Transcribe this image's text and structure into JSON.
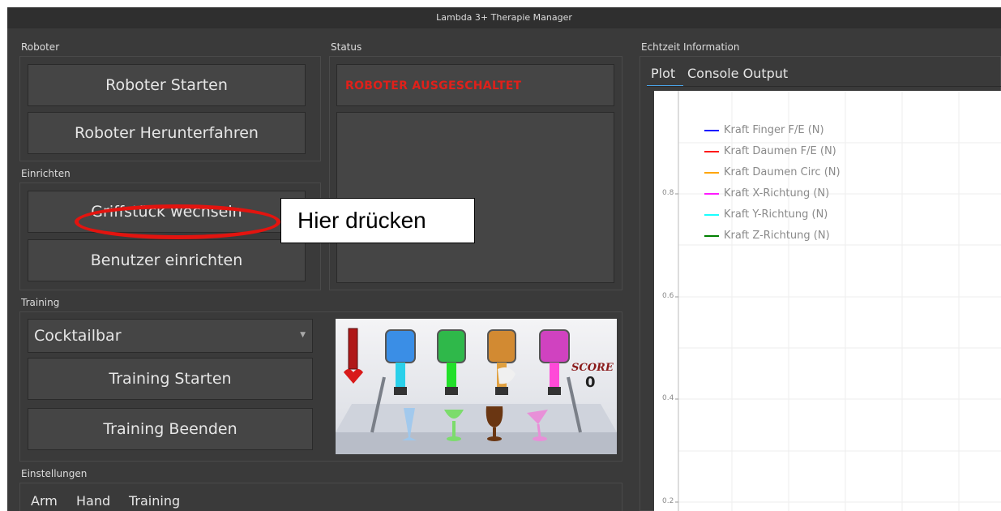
{
  "window": {
    "title": "Lambda 3+ Therapie Manager"
  },
  "roboter": {
    "label": "Roboter",
    "start_label": "Roboter Starten",
    "shutdown_label": "Roboter Herunterfahren"
  },
  "status": {
    "label": "Status",
    "text": "ROBOTER AUSGESCHALTET",
    "color": "#e0201a"
  },
  "einrichten": {
    "label": "Einrichten",
    "griff_label": "Griffstück wechseln",
    "benutzer_label": "Benutzer einrichten"
  },
  "training": {
    "label": "Training",
    "game_selected": "Cocktailbar",
    "start_label": "Training Starten",
    "stop_label": "Training Beenden",
    "preview": {
      "score_label": "SCORE",
      "score_value": "0"
    }
  },
  "einstellungen": {
    "label": "Einstellungen",
    "tabs": [
      "Arm",
      "Hand",
      "Training"
    ]
  },
  "echtzeit": {
    "label": "Echtzeit Information",
    "tabs": [
      "Plot",
      "Console Output"
    ],
    "active_tab": "Plot"
  },
  "plot": {
    "legend": [
      {
        "label": "Kraft Finger F/E (N)",
        "color": "#1a1aff"
      },
      {
        "label": "Kraft Daumen F/E (N)",
        "color": "#ff1a1a"
      },
      {
        "label": "Kraft Daumen Circ (N)",
        "color": "#ffa500"
      },
      {
        "label": "Kraft X-Richtung (N)",
        "color": "#ff1aff"
      },
      {
        "label": "Kraft Y-Richtung (N)",
        "color": "#1affff"
      },
      {
        "label": "Kraft Z-Richtung (N)",
        "color": "#008000"
      }
    ],
    "y_ticks": [
      "0.8",
      "0.6",
      "0.4",
      "0.2"
    ]
  },
  "annotation": {
    "callout_text": "Hier drücken",
    "oval_color": "#e3140f"
  }
}
